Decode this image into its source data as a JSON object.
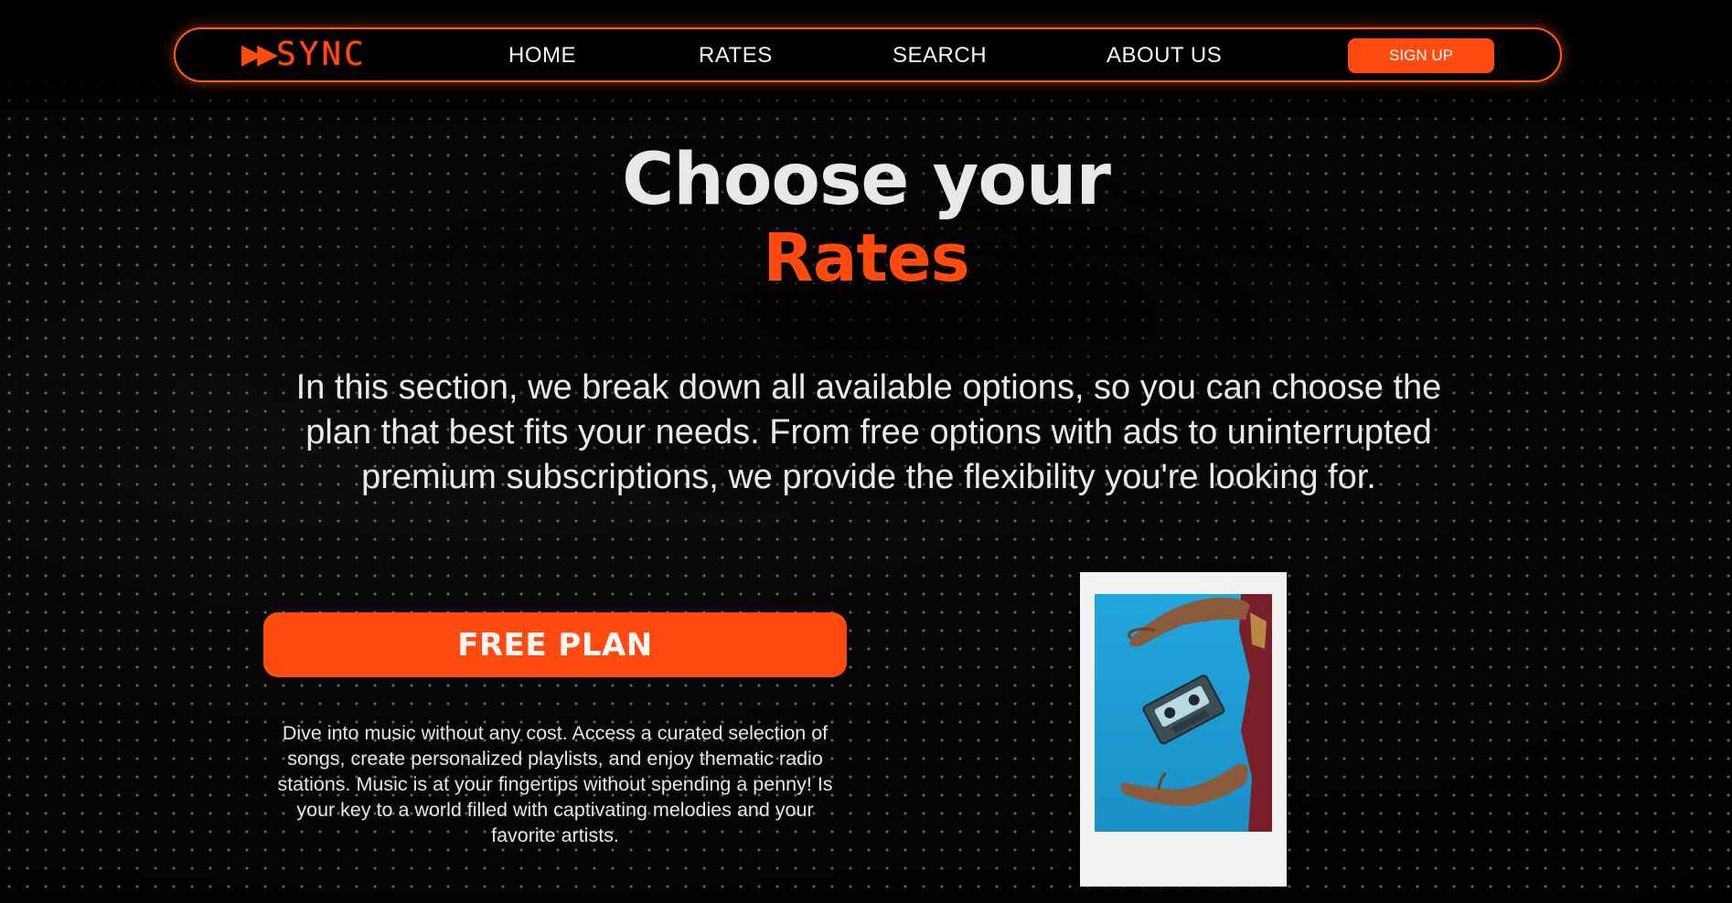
{
  "brand": {
    "logo_mark": "▶▶",
    "logo_text": "SYNC",
    "accent_color": "#ff4b0f"
  },
  "nav": {
    "items": [
      {
        "label": "HOME"
      },
      {
        "label": "RATES"
      },
      {
        "label": "SEARCH"
      },
      {
        "label": "ABOUT US"
      }
    ],
    "signup_label": "SIGN UP"
  },
  "hero": {
    "title_line1": "Choose your",
    "title_line2": "Rates",
    "intro_lines": [
      "In this section, we break down all available options, so you can choose the",
      "plan that best fits your needs. From free options with ads to uninterrupted",
      "premium subscriptions, we provide the flexibility you're looking for."
    ]
  },
  "plan": {
    "button_label": "FREE PLAN",
    "description_lines": [
      "Dive into music without any cost. Access a curated selection of",
      "songs, create personalized playlists, and enjoy thematic radio",
      "stations. Music is at your fingertips without spending a penny! Is",
      "your key to a world filled with captivating melodies and your",
      "favorite artists."
    ]
  },
  "image": {
    "icon": "cassette-photo"
  }
}
